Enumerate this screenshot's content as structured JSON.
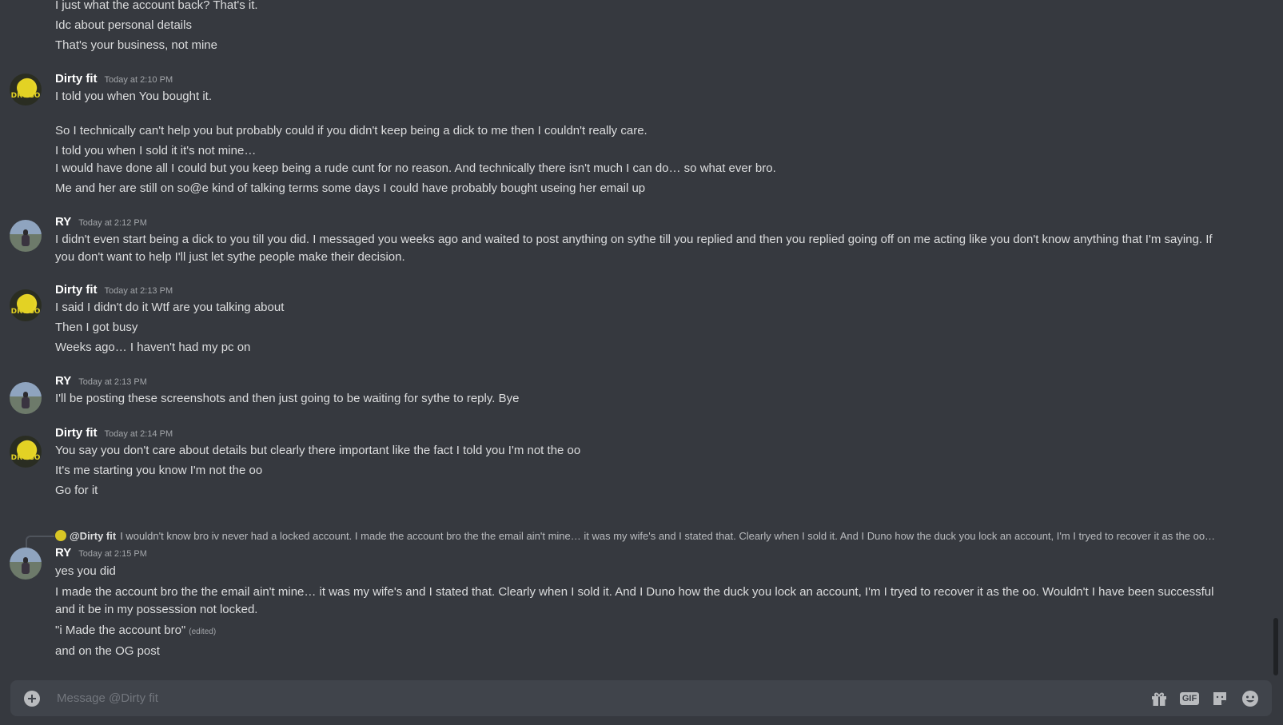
{
  "composer": {
    "placeholder": "Message @Dirty fit",
    "gif_label": "GIF",
    "icons": [
      "add-attachment-icon",
      "gift-icon",
      "gif-icon",
      "sticker-icon",
      "emoji-icon"
    ]
  },
  "colors": {
    "background": "#36393f",
    "composer": "#40444b",
    "text": "#dcddde",
    "username": "#ffffff",
    "muted": "#a3a6aa"
  },
  "messages": {
    "top": {
      "lines": [
        "I just what the account back? That's it.",
        "Idc about personal details",
        "That's your business, not mine"
      ]
    },
    "m1": {
      "author": "Dirty fit",
      "time": "Today at 2:10 PM",
      "lines": [
        "I told you when You bought it.",
        "So I technically can't help you but probably could if you didn't keep being a dick to me then I couldn't really care.",
        "I told you when I sold it it's not mine…",
        "I would have done all I could but you keep being a rude cunt for no reason. And technically there isn't much I can do… so what ever bro.",
        "Me and her are still on so@e kind of talking terms some days I could have probably bought useing her email up"
      ]
    },
    "m2": {
      "author": "RY",
      "time": "Today at 2:12 PM",
      "lines": [
        "I didn't even start being a dick to you till you did. I messaged you weeks ago and waited to post anything on sythe till you replied and then you replied going off on me acting like you don't know anything that I'm saying. If you don't want to help I'll just let sythe people make their decision."
      ]
    },
    "m3": {
      "author": "Dirty fit",
      "time": "Today at 2:13 PM",
      "lines": [
        "I said I didn't do it Wtf are you talking about",
        "Then I got busy",
        "Weeks ago… I haven't had my pc on"
      ]
    },
    "m4": {
      "author": "RY",
      "time": "Today at 2:13 PM",
      "lines": [
        "I'll be posting these screenshots and then just going to be waiting for sythe to reply. Bye"
      ]
    },
    "m5": {
      "author": "Dirty fit",
      "time": "Today at 2:14 PM",
      "lines": [
        "You say you don't care about details but clearly there important like the fact I told you I'm not the oo",
        "It's me starting you know I'm not the oo",
        "Go for it"
      ]
    },
    "m6": {
      "reply": {
        "author": "@Dirty fit",
        "text": "I wouldn't know bro iv never had a locked account.    I made the account bro the the email ain't mine… it was my wife's and I stated that.   Clearly when I sold it.  And I Duno how the duck you lock an account, I'm I tryed to recover it as the oo…"
      },
      "author": "RY",
      "time": "Today at 2:15 PM",
      "lines": [
        "yes you did",
        "I made the account bro the the email ain't mine… it was my wife's and I stated that.   Clearly when I sold it.  And I Duno how the duck you lock an account, I'm I tryed to recover it as the oo. Wouldn't I have been successful and it be in my possession not locked.",
        "\"i Made the account bro\"",
        "and on the OG post"
      ],
      "edited": "(edited)"
    }
  }
}
